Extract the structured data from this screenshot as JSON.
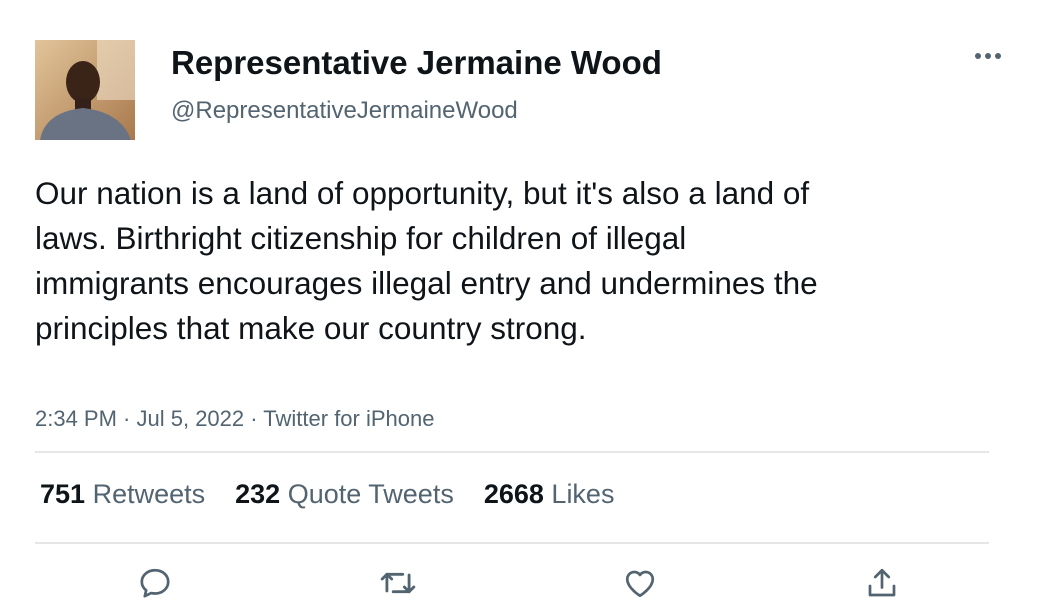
{
  "author": {
    "display_name": "Representative Jermaine Wood",
    "handle": "@RepresentativeJermaineWood"
  },
  "tweet": {
    "text": "Our nation is a land of opportunity, but it's also a land of laws. Birthright citizenship for children of illegal immigrants encourages illegal entry and undermines the principles that make our country strong.",
    "time": "2:34 PM",
    "date": "Jul 5, 2022",
    "source": "Twitter for iPhone",
    "separator": " · "
  },
  "stats": {
    "retweets_count": "751",
    "retweets_label": "Retweets",
    "quotes_count": "232",
    "quotes_label": "Quote Tweets",
    "likes_count": "2668",
    "likes_label": "Likes"
  },
  "icons": {
    "more": "more-horizontal-icon",
    "reply": "reply-icon",
    "retweet": "retweet-icon",
    "like": "heart-icon",
    "share": "share-icon"
  },
  "colors": {
    "text": "#0f1419",
    "secondary": "#536471",
    "icon": "#536471",
    "divider": "#e6e6e6"
  }
}
